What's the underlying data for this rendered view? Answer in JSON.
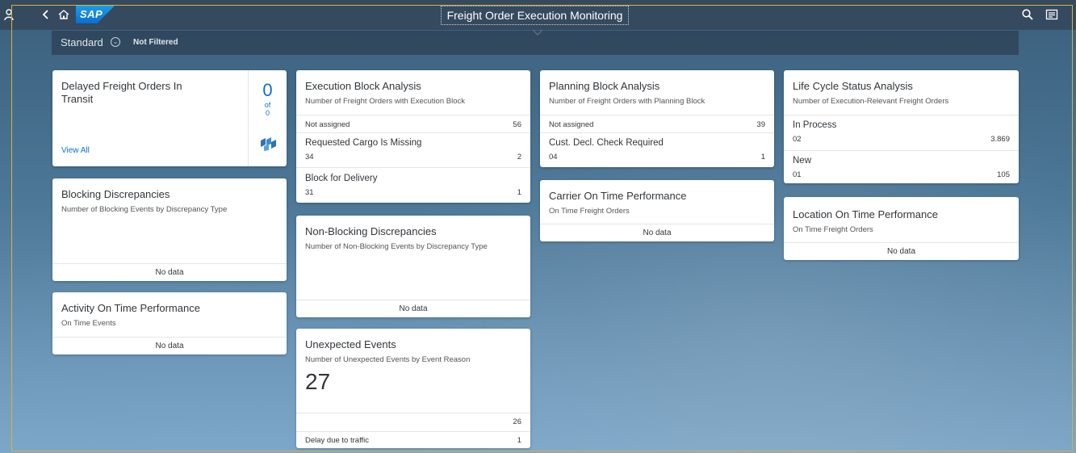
{
  "shell": {
    "logo": "SAP",
    "app_title": "Freight Order Execution Monitoring"
  },
  "filterbar": {
    "variant": "Standard",
    "status": "Not Filtered"
  },
  "cards": {
    "delayed": {
      "title": "Delayed Freight Orders In Transit",
      "count": "0",
      "of": "of",
      "total": "0",
      "link": "View All"
    },
    "blocking": {
      "title": "Blocking Discrepancies",
      "subtitle": "Number of Blocking Events by Discrepancy Type",
      "nodata": "No data"
    },
    "activity": {
      "title": "Activity On Time Performance",
      "subtitle": "On Time Events",
      "nodata": "No data"
    },
    "execution": {
      "title": "Execution Block Analysis",
      "subtitle": "Number of Freight Orders with Execution Block",
      "rows": [
        {
          "label": "Not assigned",
          "code": "",
          "value": "56"
        },
        {
          "label": "Requested Cargo Is Missing",
          "code": "34",
          "value": "2"
        },
        {
          "label": "Block for Delivery",
          "code": "31",
          "value": "1"
        }
      ]
    },
    "nonblocking": {
      "title": "Non-Blocking Discrepancies",
      "subtitle": "Number of Non-Blocking Events by Discrepancy Type",
      "nodata": "No data"
    },
    "unexpected": {
      "title": "Unexpected Events",
      "subtitle": "Number of Unexpected Events by Event Reason",
      "kpi": "27",
      "total_value": "26",
      "rows": [
        {
          "label": "Delay due to traffic",
          "value": "1"
        }
      ]
    },
    "planning": {
      "title": "Planning Block Analysis",
      "subtitle": "Number of Freight Orders with Planning Block",
      "rows": [
        {
          "label": "Not assigned",
          "code": "",
          "value": "39"
        },
        {
          "label": "Cust. Decl. Check Required",
          "code": "04",
          "value": "1"
        }
      ]
    },
    "carrier": {
      "title": "Carrier On Time Performance",
      "subtitle": "On Time Freight Orders",
      "nodata": "No data"
    },
    "lifecycle": {
      "title": "Life Cycle Status Analysis",
      "subtitle": "Number of Execution-Relevant Freight Orders",
      "rows": [
        {
          "label": "In Process",
          "code": "02",
          "value": "3.869"
        },
        {
          "label": "New",
          "code": "01",
          "value": "105"
        }
      ]
    },
    "location": {
      "title": "Location On Time Performance",
      "subtitle": "On Time Freight Orders",
      "nodata": "No data"
    }
  }
}
